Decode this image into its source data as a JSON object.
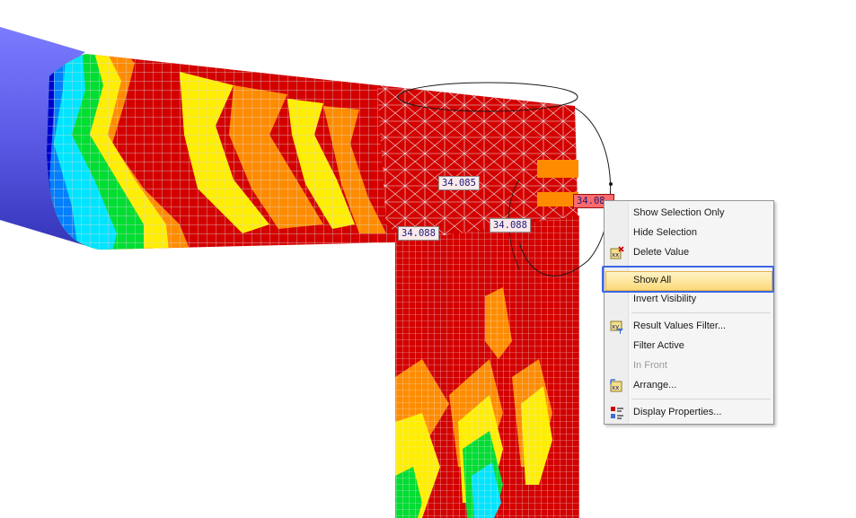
{
  "labels": [
    "34.085",
    "34.088",
    "34.088",
    "34.08"
  ],
  "menu": {
    "items": [
      {
        "label": "Show Selection Only"
      },
      {
        "label": "Hide Selection"
      },
      {
        "label": "Delete Value"
      },
      {
        "label": "Show All"
      },
      {
        "label": "Invert Visibility"
      },
      {
        "label": "Result Values Filter..."
      },
      {
        "label": "Filter Active"
      },
      {
        "label": "In Front"
      },
      {
        "label": "Arrange..."
      },
      {
        "label": "Display Properties..."
      }
    ]
  },
  "icons": [
    "delete-value-icon",
    "result-values-filter-icon",
    "arrange-icon",
    "display-properties-icon"
  ],
  "colors": {
    "highlight": "#fbd978",
    "focus_ring": "#3d66e8",
    "mesh_red": "#d40000",
    "pipe_blue": "#5b5be6"
  }
}
